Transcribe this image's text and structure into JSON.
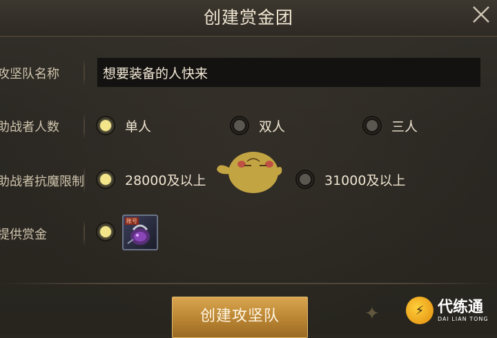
{
  "dialog": {
    "title": "创建赏金团",
    "close_icon": "close-x-icon"
  },
  "form": {
    "team_name": {
      "label": "攻坚队名称",
      "value": "想要装备的人快来"
    },
    "helper_count": {
      "label": "助战者人数",
      "options": [
        "单人",
        "双人",
        "三人"
      ],
      "selected": "单人"
    },
    "helper_resistance": {
      "label": "助战者抗魔限制",
      "options": [
        "28000及以上",
        "31000及以上"
      ],
      "selected": "28000及以上"
    },
    "bounty": {
      "label": "提供赏金",
      "item_icon": "bounty-bag-item-icon",
      "item_tag": "账号"
    }
  },
  "actions": {
    "create_label": "创建攻坚队"
  },
  "watermark": {
    "name": "代练通",
    "subtitle": "DAI LIAN TONG"
  },
  "colors": {
    "radio_selected": "#f2e58a",
    "radio_unselected": "#5a5650",
    "button": "#c08a36"
  }
}
